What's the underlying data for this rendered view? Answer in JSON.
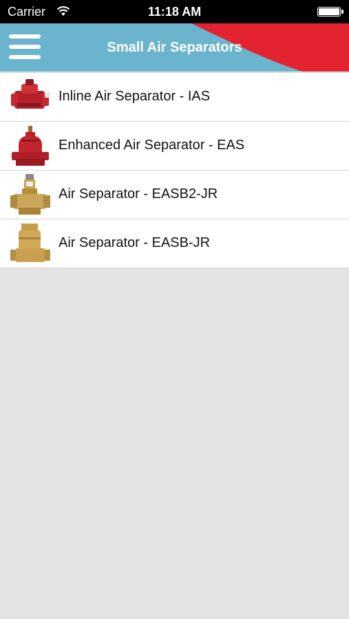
{
  "status_bar": {
    "carrier": "Carrier",
    "time": "11:18 AM",
    "wifi_icon": "wifi-icon",
    "battery_icon": "battery-icon",
    "battery_level": 1.0
  },
  "nav": {
    "title": "Small Air Separators",
    "menu_icon": "hamburger-menu-icon",
    "colors": {
      "bar": "#6ab4ce",
      "accent": "#e32430"
    }
  },
  "list": {
    "items": [
      {
        "label": "Inline Air Separator - IAS",
        "image": "red-inline-separator"
      },
      {
        "label": "Enhanced Air Separator - EAS",
        "image": "red-enhanced-separator"
      },
      {
        "label": "Air Separator - EASB2-JR",
        "image": "brass-separator-easb2-jr"
      },
      {
        "label": "Air Separator - EASB-JR",
        "image": "brass-separator-easb-jr"
      }
    ]
  },
  "colors": {
    "background": "#e3e3e3",
    "list_bg": "#ffffff",
    "divider": "#d4d4d4"
  }
}
